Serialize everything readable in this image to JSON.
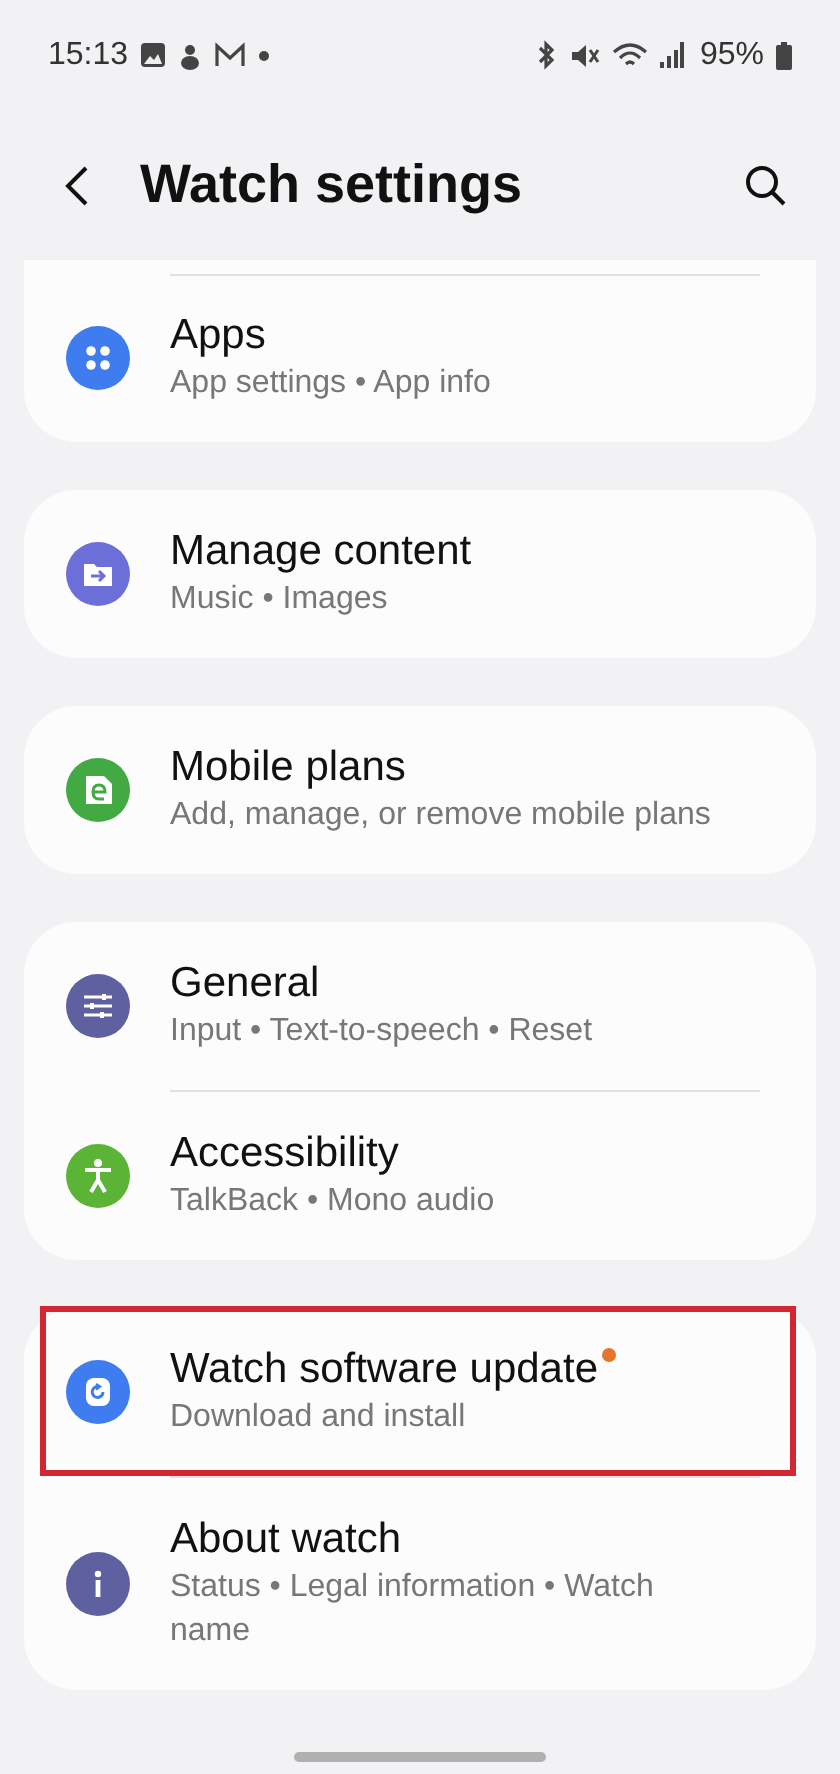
{
  "status_bar": {
    "time": "15:13",
    "battery": "95%"
  },
  "header": {
    "title": "Watch settings"
  },
  "groups": [
    {
      "cut_top": true,
      "items": [
        {
          "kind": "apps",
          "title": "Apps",
          "subtitle": "App settings • App info",
          "color": "#3e7cf0",
          "badge": false,
          "highlighted": false
        }
      ]
    },
    {
      "cut_top": false,
      "items": [
        {
          "kind": "content",
          "title": "Manage content",
          "subtitle": "Music • Images",
          "color": "#6d6fd8",
          "badge": false,
          "highlighted": false
        }
      ]
    },
    {
      "cut_top": false,
      "items": [
        {
          "kind": "plans",
          "title": "Mobile plans",
          "subtitle": "Add, manage, or remove mobile plans",
          "color": "#43a943",
          "badge": false,
          "highlighted": false
        }
      ]
    },
    {
      "cut_top": false,
      "items": [
        {
          "kind": "general",
          "title": "General",
          "subtitle": "Input • Text-to-speech • Reset",
          "color": "#5f609f",
          "badge": false,
          "highlighted": false
        },
        {
          "kind": "accessibility",
          "title": "Accessibility",
          "subtitle": "TalkBack • Mono audio",
          "color": "#5cb437",
          "badge": false,
          "highlighted": false
        }
      ]
    },
    {
      "cut_top": false,
      "items": [
        {
          "kind": "update",
          "title": "Watch software update",
          "subtitle": "Download and install",
          "color": "#3e7cf0",
          "badge": true,
          "highlighted": true
        },
        {
          "kind": "about",
          "title": "About watch",
          "subtitle": "Status • Legal information • Watch name",
          "color": "#5f609f",
          "badge": false,
          "highlighted": false
        }
      ]
    }
  ]
}
